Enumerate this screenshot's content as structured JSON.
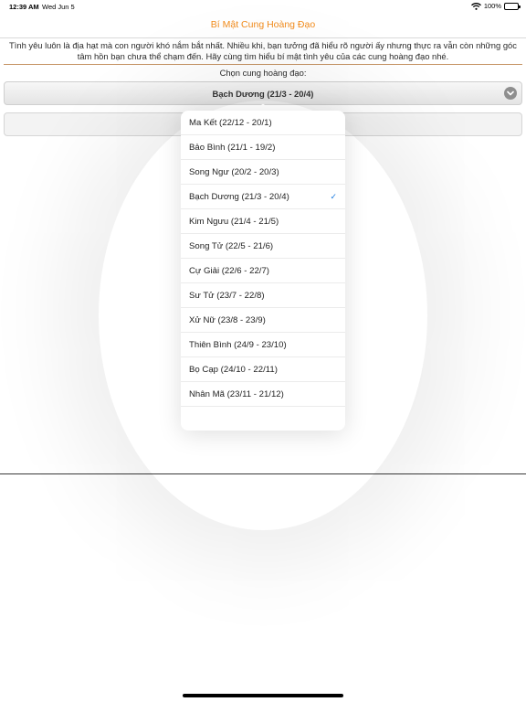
{
  "status_bar": {
    "time": "12:39 AM",
    "date": "Wed Jun 5",
    "battery_text": "100%",
    "wifi_icon": "wifi-icon",
    "battery_icon": "battery-icon"
  },
  "nav": {
    "title": "Bí Mật Cung Hoàng Đạo",
    "title_color": "#f28c1c"
  },
  "intro": {
    "text": "Tình yêu luôn là địa hạt mà con người khó nắm bắt nhất. Nhiều khi, bạn tưởng đã hiểu rõ người ấy nhưng thực ra vẫn còn những góc tâm hồn bạn chưa thể chạm đến. Hãy cùng tìm hiểu bí mật tình yêu của các cung hoàng đạo nhé."
  },
  "picker": {
    "label": "Chọn cung hoàng đạo:",
    "selected": "Bạch Dương (21/3 - 20/4)",
    "chevron_icon": "chevron-down-icon",
    "check_icon": "checkmark-icon",
    "check_color": "#1a7ae0",
    "options": [
      "Ma Kết (22/12 - 20/1)",
      "Bảo Bình (21/1 - 19/2)",
      "Song Ngư (20/2 - 20/3)",
      "Bạch Dương (21/3 - 20/4)",
      "Kim Ngưu (21/4 - 21/5)",
      "Song Tử (22/5 - 21/6)",
      "Cự Giải (22/6 - 22/7)",
      "Sư Tử (23/7 - 22/8)",
      "Xử Nữ (23/8 - 23/9)",
      "Thiên Bình (24/9 - 23/10)",
      "Bọ Cạp (24/10 - 22/11)",
      "Nhân Mã (23/11 - 21/12)"
    ]
  }
}
